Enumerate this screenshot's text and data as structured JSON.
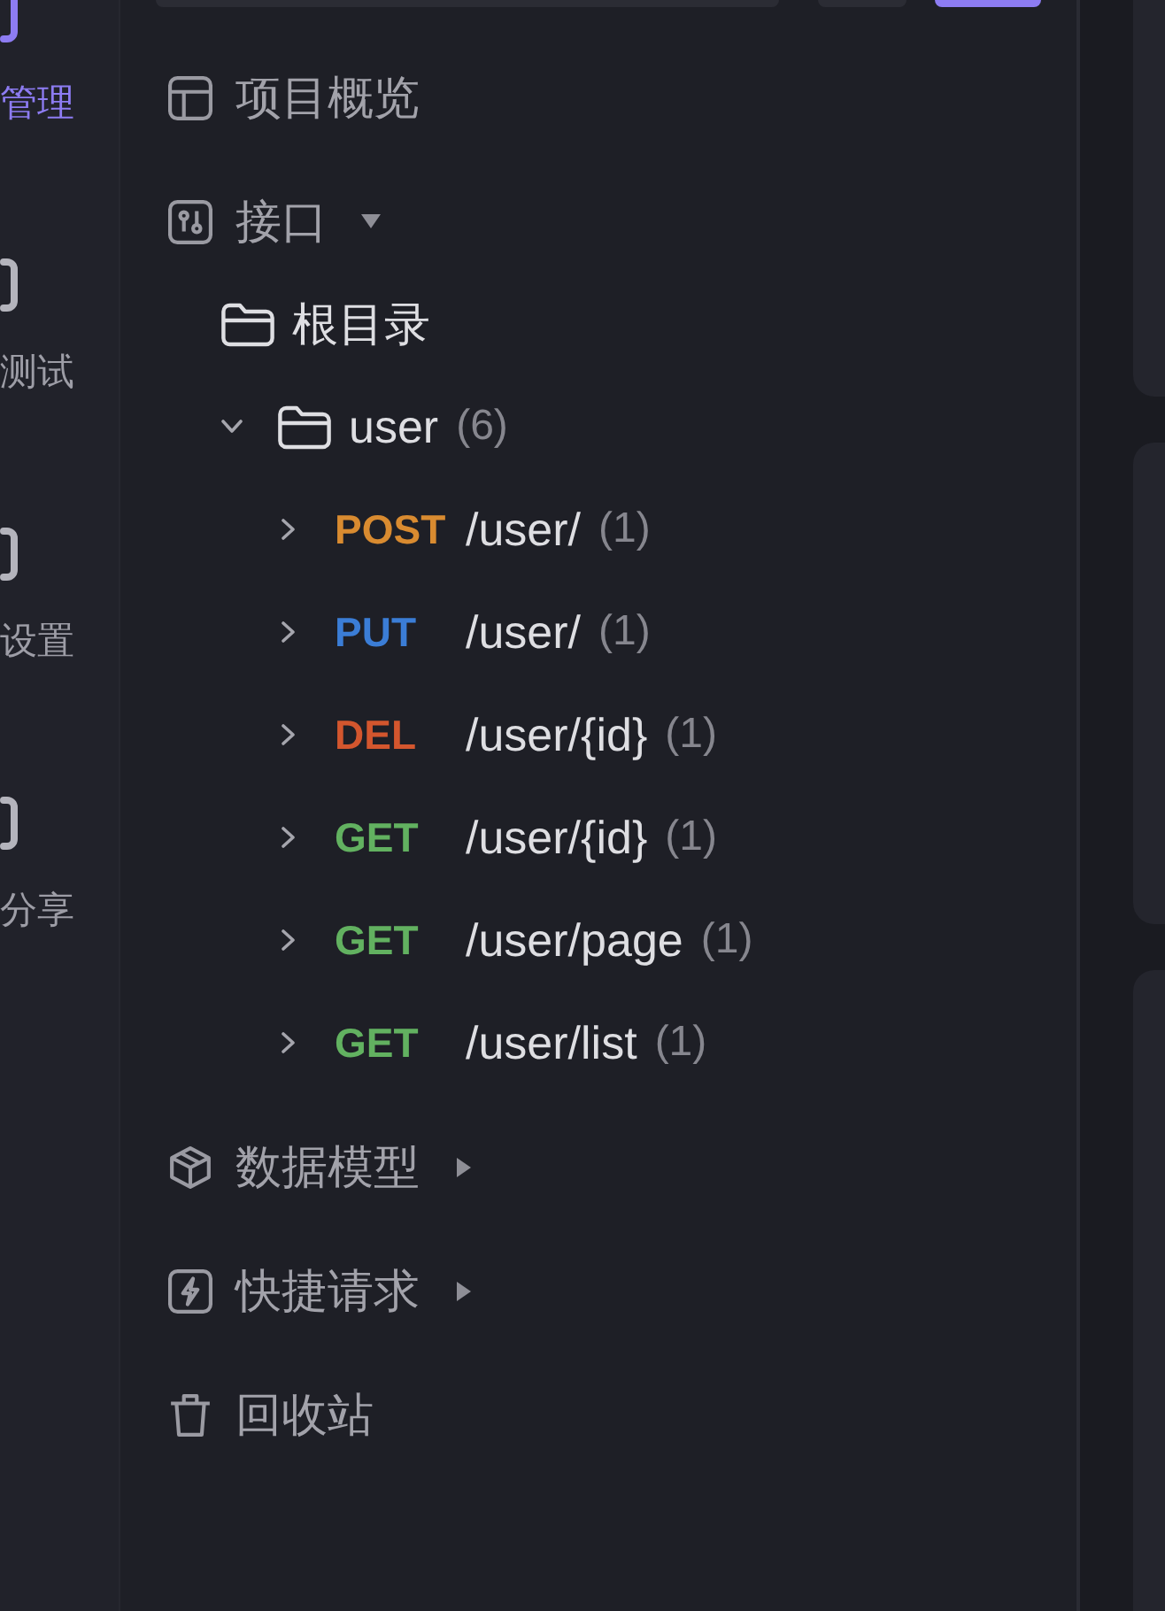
{
  "nav_rail": {
    "items": [
      {
        "label": "管理",
        "selected": true
      },
      {
        "label": "测试",
        "selected": false
      },
      {
        "label": "设置",
        "selected": false
      },
      {
        "label": "分享",
        "selected": false
      }
    ]
  },
  "sidebar": {
    "sections": [
      {
        "kind": "overview",
        "label": "项目概览"
      },
      {
        "kind": "interfaces",
        "label": "接口",
        "expanded": true,
        "children": [
          {
            "kind": "folder",
            "label": "根目录"
          },
          {
            "kind": "folder",
            "label": "user",
            "count": "(6)",
            "expanded": true,
            "children": [
              {
                "kind": "endpoint",
                "method": "POST",
                "color": "#d98b30",
                "path": "/user/",
                "count": "(1)",
                "expanded": false
              },
              {
                "kind": "endpoint",
                "method": "PUT",
                "color": "#3b7dd6",
                "path": "/user/",
                "count": "(1)",
                "expanded": false
              },
              {
                "kind": "endpoint",
                "method": "DEL",
                "color": "#d3562e",
                "path": "/user/{id}",
                "count": "(1)",
                "expanded": false
              },
              {
                "kind": "endpoint",
                "method": "GET",
                "color": "#62b160",
                "path": "/user/{id}",
                "count": "(1)",
                "expanded": false
              },
              {
                "kind": "endpoint",
                "method": "GET",
                "color": "#62b160",
                "path": "/user/page",
                "count": "(1)",
                "expanded": false
              },
              {
                "kind": "endpoint",
                "method": "GET",
                "color": "#62b160",
                "path": "/user/list",
                "count": "(1)",
                "expanded": false
              }
            ]
          }
        ]
      },
      {
        "kind": "models",
        "label": "数据模型",
        "expanded": false
      },
      {
        "kind": "requests",
        "label": "快捷请求",
        "expanded": false
      },
      {
        "kind": "trash",
        "label": "回收站"
      }
    ]
  }
}
